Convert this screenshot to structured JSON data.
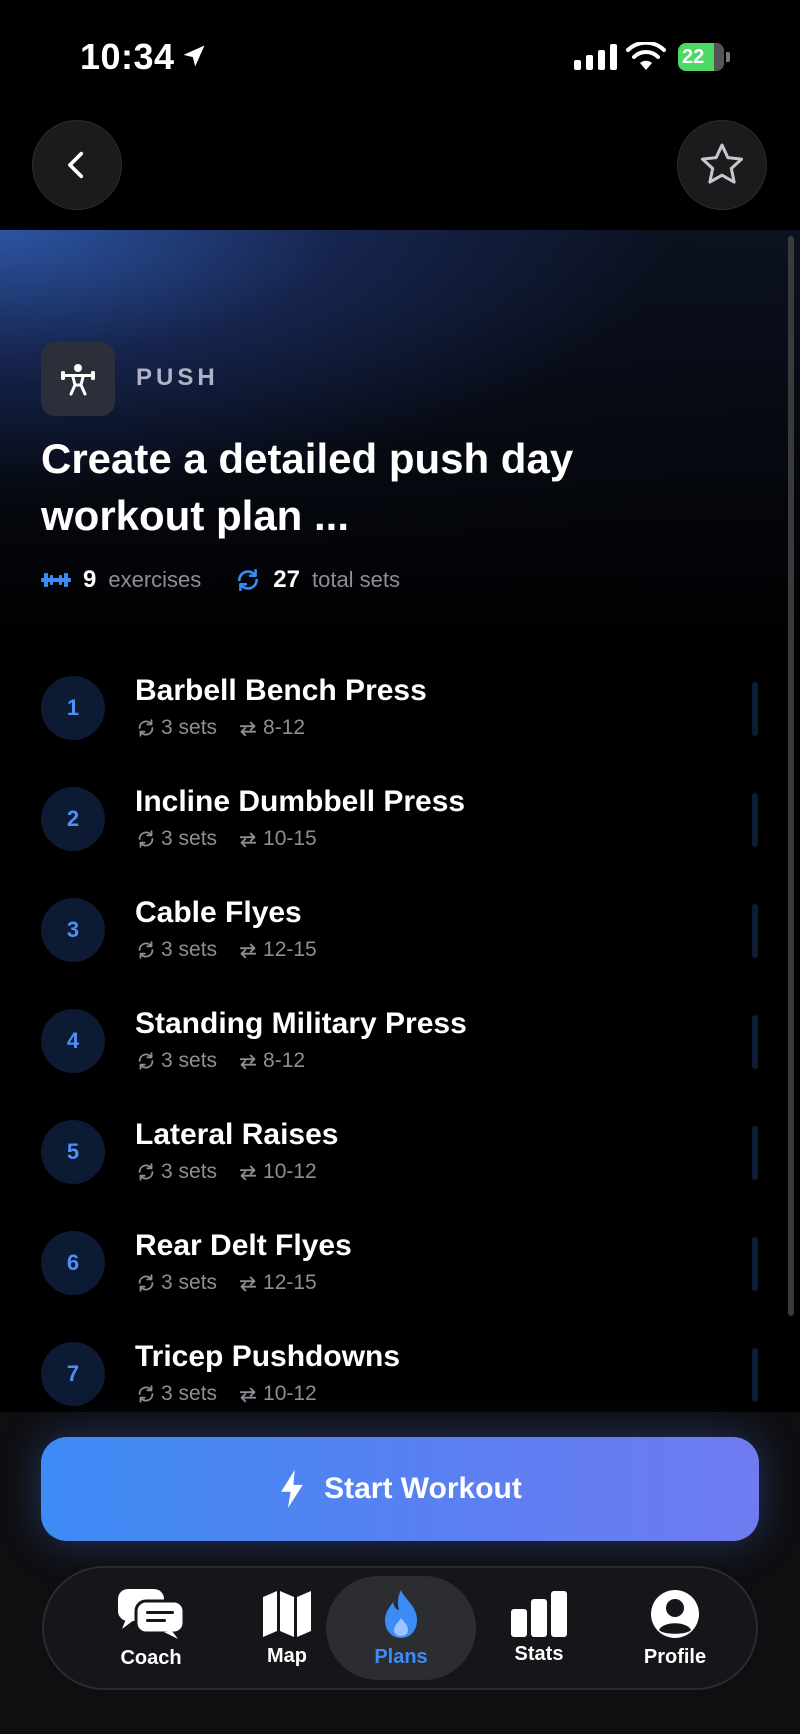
{
  "status_bar": {
    "time": "10:34",
    "battery": "22"
  },
  "header": {
    "back_icon": "chevron-left-icon",
    "favorite_icon": "star-icon"
  },
  "plan": {
    "category": "PUSH",
    "title": "Create a detailed push day workout plan ...",
    "exercise_count": "9",
    "exercise_count_label": "exercises",
    "total_sets": "27",
    "total_sets_label": "total sets"
  },
  "exercises": [
    {
      "index": "1",
      "name": "Barbell Bench Press",
      "sets": "3 sets",
      "reps": "8-12"
    },
    {
      "index": "2",
      "name": "Incline Dumbbell Press",
      "sets": "3 sets",
      "reps": "10-15"
    },
    {
      "index": "3",
      "name": "Cable Flyes",
      "sets": "3 sets",
      "reps": "12-15"
    },
    {
      "index": "4",
      "name": "Standing Military Press",
      "sets": "3 sets",
      "reps": "8-12"
    },
    {
      "index": "5",
      "name": "Lateral Raises",
      "sets": "3 sets",
      "reps": "10-12"
    },
    {
      "index": "6",
      "name": "Rear Delt Flyes",
      "sets": "3 sets",
      "reps": "12-15"
    },
    {
      "index": "7",
      "name": "Tricep Pushdowns",
      "sets": "3 sets",
      "reps": "10-12"
    }
  ],
  "actions": {
    "start_label": "Start Workout"
  },
  "tabs": [
    {
      "label": "Coach",
      "icon": "chat-bubbles-icon",
      "active": false
    },
    {
      "label": "Map",
      "icon": "map-icon",
      "active": false
    },
    {
      "label": "Plans",
      "icon": "flame-icon",
      "active": true
    },
    {
      "label": "Stats",
      "icon": "bar-chart-icon",
      "active": false
    },
    {
      "label": "Profile",
      "icon": "person-icon",
      "active": false
    }
  ],
  "colors": {
    "accent": "#3b8cf5",
    "background": "#000000",
    "button_gradient_start": "#3d8bf5",
    "button_gradient_end": "#6f7bf0"
  }
}
